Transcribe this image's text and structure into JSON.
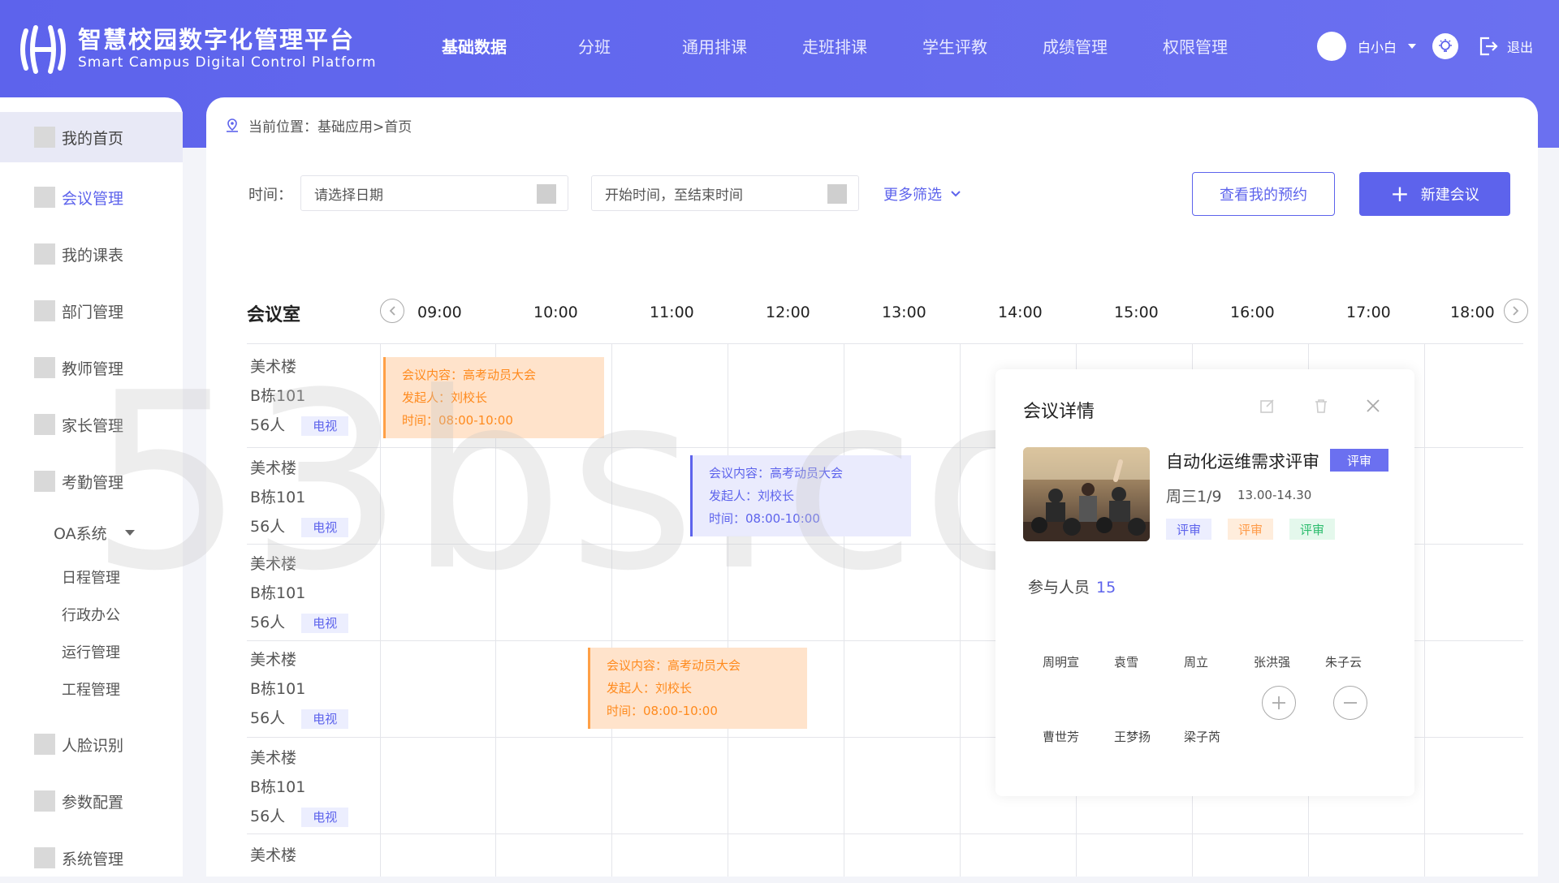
{
  "brand": {
    "title": "智慧校园数字化管理平台",
    "subtitle": "Smart Campus Digital Control Platform"
  },
  "nav": [
    "基础数据",
    "分班",
    "通用排课",
    "走班排课",
    "学生评教",
    "成绩管理",
    "权限管理"
  ],
  "user": {
    "name": "白小白",
    "logout": "退出"
  },
  "sidebar": {
    "items": [
      "我的首页",
      "会议管理",
      "我的课表",
      "部门管理",
      "教师管理",
      "家长管理",
      "考勤管理"
    ],
    "oa": "OA系统",
    "oa_sub": [
      "日程管理",
      "行政办公",
      "运行管理",
      "工程管理"
    ],
    "items2": [
      "人脸识别",
      "参数配置",
      "系统管理"
    ]
  },
  "breadcrumb": "当前位置：基础应用>首页",
  "filters": {
    "time_label": "时间：",
    "date_placeholder": "请选择日期",
    "range_placeholder": "开始时间，至结束时间",
    "more": "更多筛选"
  },
  "buttons": {
    "my_booking": "查看我的预约",
    "new_meeting": "新建会议"
  },
  "schedule": {
    "room_header": "会议室",
    "times": [
      "09:00",
      "10:00",
      "11:00",
      "12:00",
      "13:00",
      "14:00",
      "15:00",
      "16:00",
      "17:00",
      "18:00"
    ],
    "rooms": [
      {
        "building": "美术楼",
        "room": "B栋101",
        "capacity": "56人",
        "tag": "电视"
      },
      {
        "building": "美术楼",
        "room": "B栋101",
        "capacity": "56人",
        "tag": "电视"
      },
      {
        "building": "美术楼",
        "room": "B栋101",
        "capacity": "56人",
        "tag": "电视"
      },
      {
        "building": "美术楼",
        "room": "B栋101",
        "capacity": "56人",
        "tag": "电视"
      },
      {
        "building": "美术楼",
        "room": "B栋101",
        "capacity": "56人",
        "tag": "电视"
      },
      {
        "building": "美术楼"
      }
    ],
    "events": [
      {
        "content": "会议内容：高考动员大会",
        "host": "发起人：刘校长",
        "time": "时间：08:00-10:00"
      },
      {
        "content": "会议内容：高考动员大会",
        "host": "发起人：刘校长",
        "time": "时间：08:00-10:00"
      },
      {
        "content": "会议内容：高考动员大会",
        "host": "发起人：刘校长",
        "time": "时间：08:00-10:00"
      }
    ]
  },
  "detail": {
    "title": "会议详情",
    "meeting_title": "自动化运维需求评审",
    "badge": "评审",
    "date": "周三1/9",
    "time": "13.00-14.30",
    "chips": [
      "评审",
      "评审",
      "评审"
    ],
    "participants_label": "参与人员",
    "participants_count": "15",
    "people_row1": [
      "周明宣",
      "袁雪",
      "周立",
      "张洪强",
      "朱子云"
    ],
    "people_row2": [
      "曹世芳",
      "王梦扬",
      "梁子芮"
    ]
  },
  "watermark": "53bs.com",
  "colors": {
    "primary": "#5d63ec",
    "orange": "#ff8a1d",
    "green": "#2dbd6e"
  }
}
